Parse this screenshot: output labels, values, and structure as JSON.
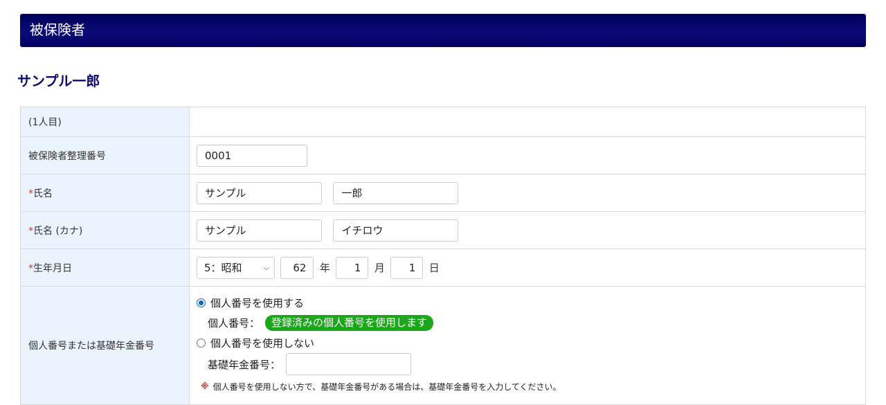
{
  "section": {
    "title": "被保険者"
  },
  "person": {
    "name": "サンプル一郎"
  },
  "rows": {
    "index": {
      "label": "(1人目)"
    },
    "insured_number": {
      "label": "被保険者整理番号",
      "value": "0001"
    },
    "name": {
      "required_mark": "*",
      "label": "氏名",
      "last_name": "サンプル",
      "first_name": "一郎"
    },
    "kana": {
      "required_mark": "*",
      "label": "氏名 (カナ)",
      "last_name": "サンプル",
      "first_name": "イチロウ"
    },
    "birth": {
      "required_mark": "*",
      "label": "生年月日",
      "era": "5：昭和",
      "year": "62",
      "year_unit": "年",
      "month": "1",
      "month_unit": "月",
      "day": "1",
      "day_unit": "日"
    },
    "my_number": {
      "label": "個人番号または基礎年金番号",
      "option_use": "個人番号を使用する",
      "option_use_checked": true,
      "my_number_label": "個人番号：",
      "registered_badge": "登録済みの個人番号を使用します",
      "option_not_use": "個人番号を使用しない",
      "option_not_use_checked": false,
      "pension_label": "基礎年金番号：",
      "pension_value": "",
      "note_mark": "※",
      "note_text": "個人番号を使用しない方で、基礎年金番号がある場合は、基礎年金番号を入力してください。"
    }
  },
  "colors": {
    "header_bg": "#000060",
    "name_text": "#0a0a6e",
    "label_bg": "#ebf3fc",
    "required": "#d0342c",
    "badge": "#1aa71a",
    "radio_checked": "#0a66c2"
  },
  "icons": {
    "select_chevron": "chevron-down-icon",
    "note_mark": "asterisk-note-icon"
  }
}
